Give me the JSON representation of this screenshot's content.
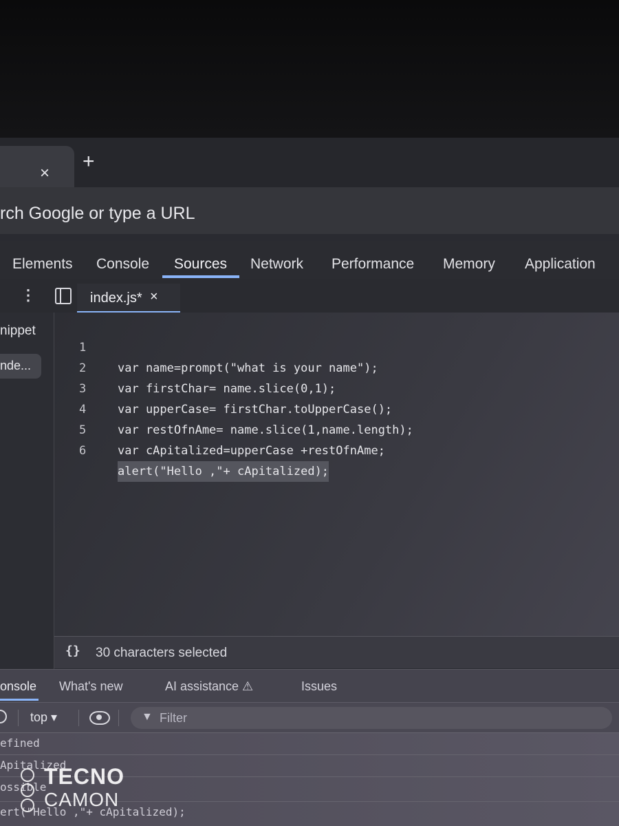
{
  "browser": {
    "tab_close": "×",
    "new_tab": "+",
    "omnibox_placeholder": "rch Google or type a URL"
  },
  "devtools": {
    "tabs": [
      {
        "label": "Elements"
      },
      {
        "label": "Console"
      },
      {
        "label": "Sources",
        "active": true
      },
      {
        "label": "Network"
      },
      {
        "label": "Performance"
      },
      {
        "label": "Memory"
      },
      {
        "label": "Application"
      }
    ]
  },
  "sources": {
    "more_icon": "⋮",
    "file_tab": {
      "name": "index.js*",
      "close": "×"
    },
    "navigator": {
      "section": "nippet",
      "file": "nde..."
    },
    "code_lines": [
      {
        "n": "1",
        "text": "var name=prompt(\"what is your name\");"
      },
      {
        "n": "2",
        "text": "var firstChar= name.slice(0,1);"
      },
      {
        "n": "3",
        "text": "var upperCase= firstChar.toUpperCase();"
      },
      {
        "n": "4",
        "text": "var restOfnAme= name.slice(1,name.length);"
      },
      {
        "n": "5",
        "text": "var cApitalized=upperCase +restOfnAme;"
      },
      {
        "n": "6",
        "text": "alert(\"Hello ,\"+ cApitalized);"
      }
    ],
    "status_icon": "{}",
    "status_text": "30 characters selected"
  },
  "drawer": {
    "tabs": [
      {
        "label": "onsole",
        "active": true
      },
      {
        "label": "What's new"
      },
      {
        "label": "AI assistance ⚠"
      },
      {
        "label": "Issues"
      }
    ],
    "context": "top ▾",
    "filter_placeholder": "Filter",
    "console_lines": [
      "efined",
      "Apitalized",
      "ossible",
      "ert(\"Hello ,\"+ cApitalized);"
    ]
  },
  "watermark": {
    "brand": "TECNO",
    "model": "CAMON"
  },
  "colors": {
    "accent": "#8ab4f8",
    "string": "#f2c15f",
    "keyword": "#b7b9ff"
  }
}
